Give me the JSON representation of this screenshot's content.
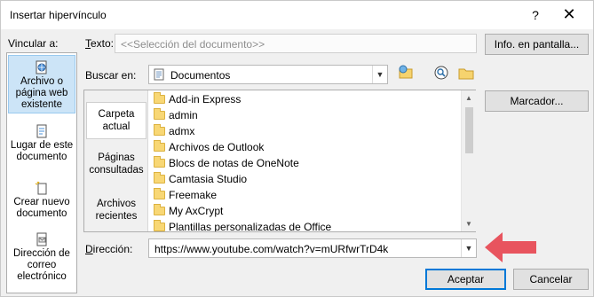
{
  "window": {
    "title": "Insertar hipervínculo",
    "help_glyph": "?",
    "close_glyph": "✕"
  },
  "link_to": {
    "label": "Vincular a:",
    "items": [
      {
        "label": "Archivo o página web existente",
        "icon": "web-page-icon",
        "selected": true
      },
      {
        "label": "Lugar de este documento",
        "icon": "document-place-icon",
        "selected": false
      },
      {
        "label": "Crear nuevo documento",
        "icon": "new-document-icon",
        "selected": false
      },
      {
        "label": "Dirección de correo electrónico",
        "icon": "email-icon",
        "selected": false
      }
    ]
  },
  "text_field": {
    "label": "Texto:",
    "value": "<<Selección del documento>>"
  },
  "screen_tip_button": "Info. en pantalla...",
  "look_in": {
    "label": "Buscar en:",
    "value": "Documentos",
    "icon": "documents-folder-icon"
  },
  "toolbar_icons": [
    "browse-web-icon",
    "browse-file-icon",
    "recent-folder-icon"
  ],
  "bookmark_button": "Marcador...",
  "tabs": [
    {
      "label": "Carpeta actual",
      "selected": true
    },
    {
      "label": "Páginas consultadas",
      "selected": false
    },
    {
      "label": "Archivos recientes",
      "selected": false
    }
  ],
  "files": [
    "Add-in Express",
    "admin",
    "admx",
    "Archivos de Outlook",
    "Blocs de notas de OneNote",
    "Camtasia Studio",
    "Freemake",
    "My AxCrypt",
    "Plantillas personalizadas de Office"
  ],
  "address": {
    "label": "Dirección:",
    "value": "https://www.youtube.com/watch?v=mURfwrTrD4k"
  },
  "ok_button": "Aceptar",
  "cancel_button": "Cancelar",
  "colors": {
    "accent": "#0078d7",
    "selection": "#cce4f7",
    "annotation_arrow": "#e8545e"
  }
}
